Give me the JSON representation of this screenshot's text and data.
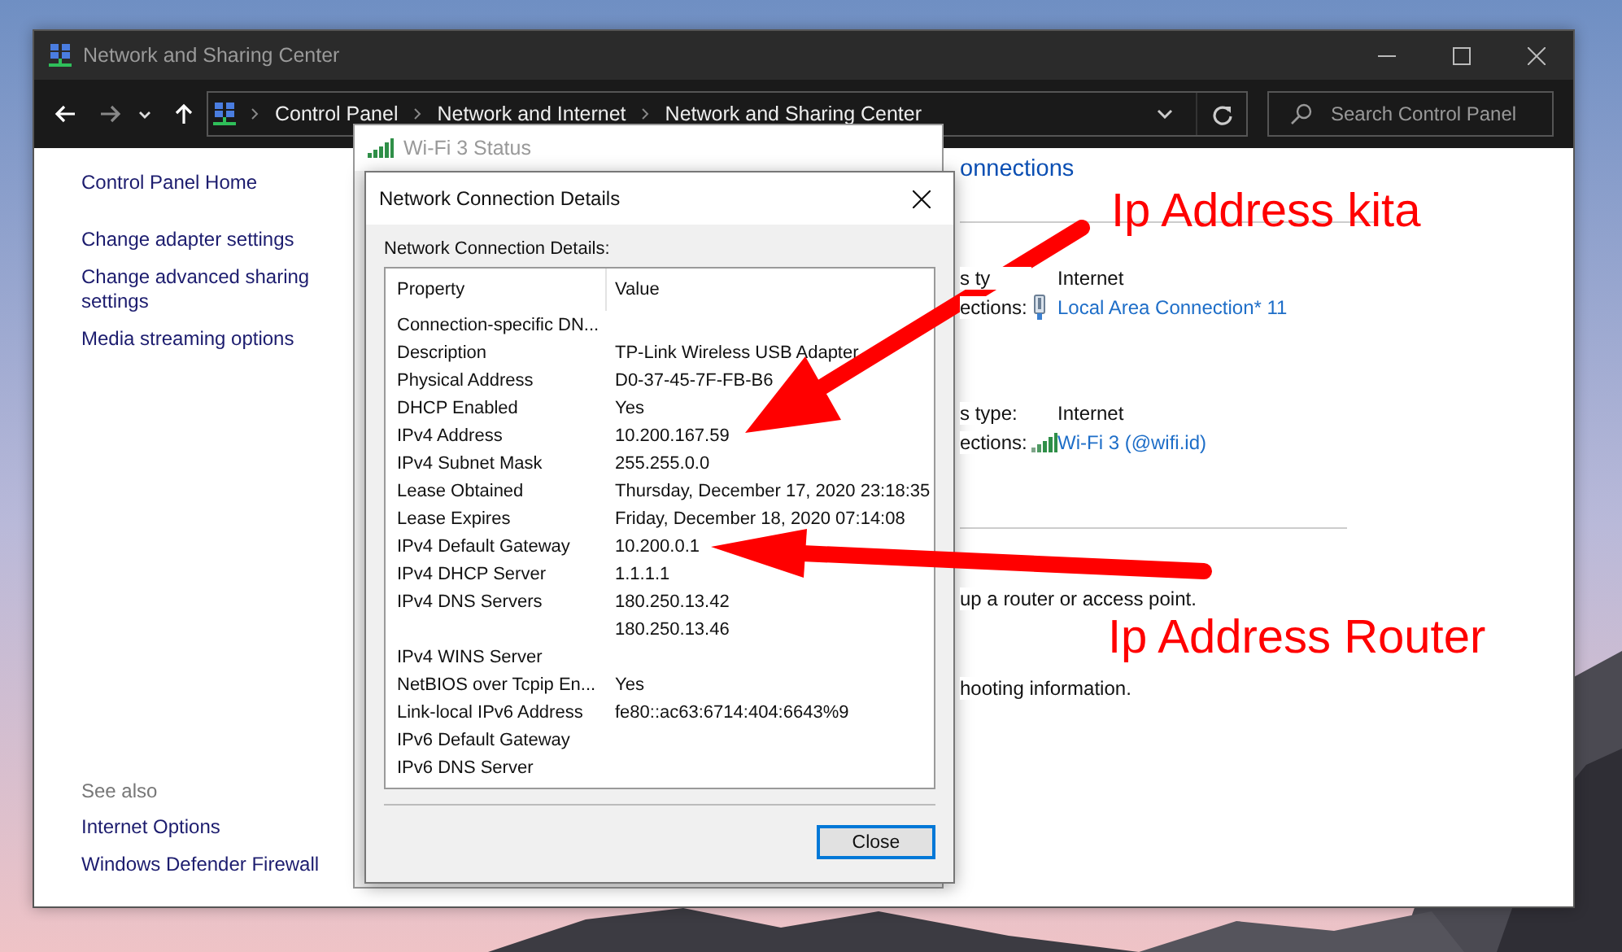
{
  "window": {
    "title": "Network and Sharing Center"
  },
  "address_bar": {
    "breadcrumbs": [
      "Control Panel",
      "Network and Internet",
      "Network and Sharing Center"
    ]
  },
  "search": {
    "placeholder": "Search Control Panel"
  },
  "sidebar": {
    "items": [
      "Control Panel Home",
      "Change adapter settings",
      "Change advanced sharing settings",
      "Media streaming options"
    ],
    "see_also_heading": "See also",
    "see_also": [
      "Internet Options",
      "Windows Defender Firewall"
    ]
  },
  "main": {
    "heading": "onnections",
    "connections": [
      {
        "rows": [
          {
            "kind": "text",
            "label": "s ty",
            "value": "Internet"
          },
          {
            "kind": "adapter-link",
            "label": "ections:",
            "value": "Local Area Connection* 11"
          }
        ]
      },
      {
        "rows": [
          {
            "kind": "text",
            "label": "s type:",
            "value": "Internet"
          },
          {
            "kind": "wifi-link",
            "label": "ections:",
            "value": "Wi-Fi 3 (@wifi.id)"
          }
        ]
      }
    ],
    "notes": [
      "up a router or access point.",
      "hooting information."
    ]
  },
  "status_window": {
    "title": "Wi-Fi 3 Status"
  },
  "details_dialog": {
    "title": "Network Connection Details",
    "group_label": "Network Connection Details:",
    "columns": [
      "Property",
      "Value"
    ],
    "rows": [
      {
        "property": "Connection-specific DN..."
      },
      {
        "property": "Description",
        "value": "TP-Link Wireless USB Adapter"
      },
      {
        "property": "Physical Address",
        "value": "D0-37-45-7F-FB-B6"
      },
      {
        "property": "DHCP Enabled",
        "value": "Yes"
      },
      {
        "property": "IPv4 Address",
        "value": "10.200.167.59"
      },
      {
        "property": "IPv4 Subnet Mask",
        "value": "255.255.0.0"
      },
      {
        "property": "Lease Obtained",
        "value": "Thursday, December 17, 2020 23:18:35"
      },
      {
        "property": "Lease Expires",
        "value": "Friday, December 18, 2020 07:14:08"
      },
      {
        "property": "IPv4 Default Gateway",
        "value": "10.200.0.1"
      },
      {
        "property": "IPv4 DHCP Server",
        "value": "1.1.1.1"
      },
      {
        "property": "IPv4 DNS Servers",
        "value": "180.250.13.42"
      },
      {
        "value": "180.250.13.46"
      },
      {
        "property": "IPv4 WINS Server"
      },
      {
        "property": "NetBIOS over Tcpip En...",
        "value": "Yes"
      },
      {
        "property": "Link-local IPv6 Address",
        "value": "fe80::ac63:6714:404:6643%9"
      },
      {
        "property": "IPv6 Default Gateway"
      },
      {
        "property": "IPv6 DNS Server"
      }
    ],
    "buttons": [
      {
        "label": "Close",
        "default": true
      }
    ]
  },
  "annotations": [
    {
      "text": "Ip Address kita"
    },
    {
      "text": "Ip Address Router"
    }
  ]
}
